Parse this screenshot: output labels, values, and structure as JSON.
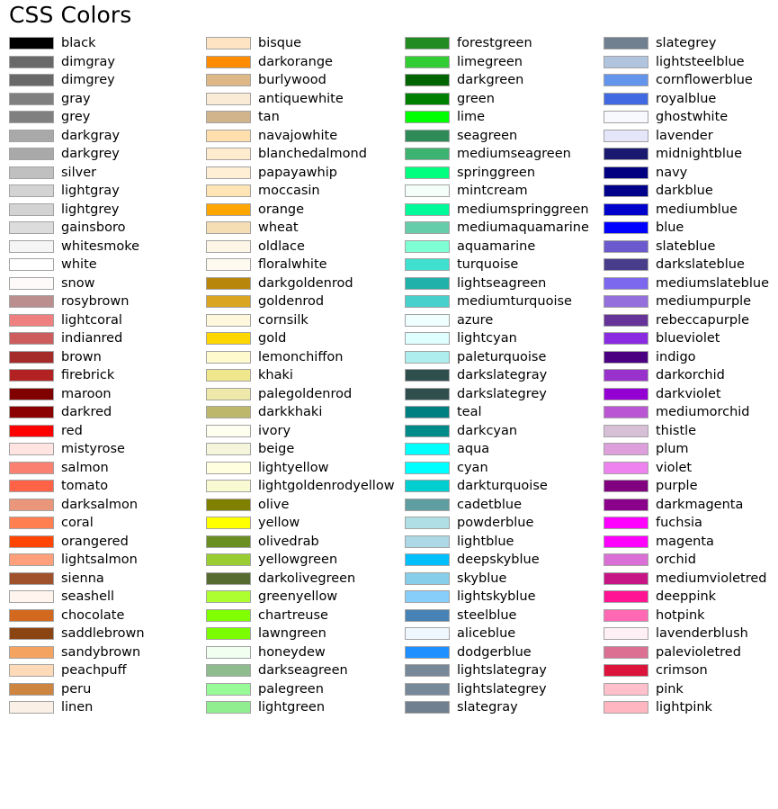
{
  "title": "CSS Colors",
  "background": "#ffffff",
  "swatch_border": "#a3a3a3",
  "chart_data": {
    "type": "table",
    "title": "CSS Colors",
    "xlabel": "",
    "ylabel": "",
    "grid": false,
    "legend_position": "none",
    "layout": {
      "columns": 4,
      "rows_per_column": 42,
      "total_swatches": 148
    },
    "columns": [
      {
        "index": 0,
        "entries": [
          {
            "name": "black",
            "hex": "#000000"
          },
          {
            "name": "dimgray",
            "hex": "#696969"
          },
          {
            "name": "dimgrey",
            "hex": "#696969"
          },
          {
            "name": "gray",
            "hex": "#808080"
          },
          {
            "name": "grey",
            "hex": "#808080"
          },
          {
            "name": "darkgray",
            "hex": "#a9a9a9"
          },
          {
            "name": "darkgrey",
            "hex": "#a9a9a9"
          },
          {
            "name": "silver",
            "hex": "#c0c0c0"
          },
          {
            "name": "lightgray",
            "hex": "#d3d3d3"
          },
          {
            "name": "lightgrey",
            "hex": "#d3d3d3"
          },
          {
            "name": "gainsboro",
            "hex": "#dcdcdc"
          },
          {
            "name": "whitesmoke",
            "hex": "#f5f5f5"
          },
          {
            "name": "white",
            "hex": "#ffffff"
          },
          {
            "name": "snow",
            "hex": "#fffafa"
          },
          {
            "name": "rosybrown",
            "hex": "#bc8f8f"
          },
          {
            "name": "lightcoral",
            "hex": "#f08080"
          },
          {
            "name": "indianred",
            "hex": "#cd5c5c"
          },
          {
            "name": "brown",
            "hex": "#a52a2a"
          },
          {
            "name": "firebrick",
            "hex": "#b22222"
          },
          {
            "name": "maroon",
            "hex": "#800000"
          },
          {
            "name": "darkred",
            "hex": "#8b0000"
          },
          {
            "name": "red",
            "hex": "#ff0000"
          },
          {
            "name": "mistyrose",
            "hex": "#ffe4e1"
          },
          {
            "name": "salmon",
            "hex": "#fa8072"
          },
          {
            "name": "tomato",
            "hex": "#ff6347"
          },
          {
            "name": "darksalmon",
            "hex": "#e9967a"
          },
          {
            "name": "coral",
            "hex": "#ff7f50"
          },
          {
            "name": "orangered",
            "hex": "#ff4500"
          },
          {
            "name": "lightsalmon",
            "hex": "#ffa07a"
          },
          {
            "name": "sienna",
            "hex": "#a0522d"
          },
          {
            "name": "seashell",
            "hex": "#fff5ee"
          },
          {
            "name": "chocolate",
            "hex": "#d2691e"
          },
          {
            "name": "saddlebrown",
            "hex": "#8b4513"
          },
          {
            "name": "sandybrown",
            "hex": "#f4a460"
          },
          {
            "name": "peachpuff",
            "hex": "#ffdab9"
          },
          {
            "name": "peru",
            "hex": "#cd853f"
          },
          {
            "name": "linen",
            "hex": "#faf0e6"
          }
        ]
      },
      {
        "index": 1,
        "entries": [
          {
            "name": "bisque",
            "hex": "#ffe4c4"
          },
          {
            "name": "darkorange",
            "hex": "#ff8c00"
          },
          {
            "name": "burlywood",
            "hex": "#deb887"
          },
          {
            "name": "antiquewhite",
            "hex": "#faebd7"
          },
          {
            "name": "tan",
            "hex": "#d2b48c"
          },
          {
            "name": "navajowhite",
            "hex": "#ffdead"
          },
          {
            "name": "blanchedalmond",
            "hex": "#ffebcd"
          },
          {
            "name": "papayawhip",
            "hex": "#ffefd5"
          },
          {
            "name": "moccasin",
            "hex": "#ffe4b5"
          },
          {
            "name": "orange",
            "hex": "#ffa500"
          },
          {
            "name": "wheat",
            "hex": "#f5deb3"
          },
          {
            "name": "oldlace",
            "hex": "#fdf5e6"
          },
          {
            "name": "floralwhite",
            "hex": "#fffaf0"
          },
          {
            "name": "darkgoldenrod",
            "hex": "#b8860b"
          },
          {
            "name": "goldenrod",
            "hex": "#daa520"
          },
          {
            "name": "cornsilk",
            "hex": "#fff8dc"
          },
          {
            "name": "gold",
            "hex": "#ffd700"
          },
          {
            "name": "lemonchiffon",
            "hex": "#fffacd"
          },
          {
            "name": "khaki",
            "hex": "#f0e68c"
          },
          {
            "name": "palegoldenrod",
            "hex": "#eee8aa"
          },
          {
            "name": "darkkhaki",
            "hex": "#bdb76b"
          },
          {
            "name": "ivory",
            "hex": "#fffff0"
          },
          {
            "name": "beige",
            "hex": "#f5f5dc"
          },
          {
            "name": "lightyellow",
            "hex": "#ffffe0"
          },
          {
            "name": "lightgoldenrodyellow",
            "hex": "#fafad2"
          },
          {
            "name": "olive",
            "hex": "#808000"
          },
          {
            "name": "yellow",
            "hex": "#ffff00"
          },
          {
            "name": "olivedrab",
            "hex": "#6b8e23"
          },
          {
            "name": "yellowgreen",
            "hex": "#9acd32"
          },
          {
            "name": "darkolivegreen",
            "hex": "#556b2f"
          },
          {
            "name": "greenyellow",
            "hex": "#adff2f"
          },
          {
            "name": "chartreuse",
            "hex": "#7fff00"
          },
          {
            "name": "lawngreen",
            "hex": "#7cfc00"
          },
          {
            "name": "honeydew",
            "hex": "#f0fff0"
          },
          {
            "name": "darkseagreen",
            "hex": "#8fbc8f"
          },
          {
            "name": "palegreen",
            "hex": "#98fb98"
          },
          {
            "name": "lightgreen",
            "hex": "#90ee90"
          }
        ]
      },
      {
        "index": 2,
        "entries": [
          {
            "name": "forestgreen",
            "hex": "#228b22"
          },
          {
            "name": "limegreen",
            "hex": "#32cd32"
          },
          {
            "name": "darkgreen",
            "hex": "#006400"
          },
          {
            "name": "green",
            "hex": "#008000"
          },
          {
            "name": "lime",
            "hex": "#00ff00"
          },
          {
            "name": "seagreen",
            "hex": "#2e8b57"
          },
          {
            "name": "mediumseagreen",
            "hex": "#3cb371"
          },
          {
            "name": "springgreen",
            "hex": "#00ff7f"
          },
          {
            "name": "mintcream",
            "hex": "#f5fffa"
          },
          {
            "name": "mediumspringgreen",
            "hex": "#00fa9a"
          },
          {
            "name": "mediumaquamarine",
            "hex": "#66cdaa"
          },
          {
            "name": "aquamarine",
            "hex": "#7fffd4"
          },
          {
            "name": "turquoise",
            "hex": "#40e0d0"
          },
          {
            "name": "lightseagreen",
            "hex": "#20b2aa"
          },
          {
            "name": "mediumturquoise",
            "hex": "#48d1cc"
          },
          {
            "name": "azure",
            "hex": "#f0ffff"
          },
          {
            "name": "lightcyan",
            "hex": "#e0ffff"
          },
          {
            "name": "paleturquoise",
            "hex": "#afeeee"
          },
          {
            "name": "darkslategray",
            "hex": "#2f4f4f"
          },
          {
            "name": "darkslategrey",
            "hex": "#2f4f4f"
          },
          {
            "name": "teal",
            "hex": "#008080"
          },
          {
            "name": "darkcyan",
            "hex": "#008b8b"
          },
          {
            "name": "aqua",
            "hex": "#00ffff"
          },
          {
            "name": "cyan",
            "hex": "#00ffff"
          },
          {
            "name": "darkturquoise",
            "hex": "#00ced1"
          },
          {
            "name": "cadetblue",
            "hex": "#5f9ea0"
          },
          {
            "name": "powderblue",
            "hex": "#b0e0e6"
          },
          {
            "name": "lightblue",
            "hex": "#add8e6"
          },
          {
            "name": "deepskyblue",
            "hex": "#00bfff"
          },
          {
            "name": "skyblue",
            "hex": "#87ceeb"
          },
          {
            "name": "lightskyblue",
            "hex": "#87cefa"
          },
          {
            "name": "steelblue",
            "hex": "#4682b4"
          },
          {
            "name": "aliceblue",
            "hex": "#f0f8ff"
          },
          {
            "name": "dodgerblue",
            "hex": "#1e90ff"
          },
          {
            "name": "lightslategray",
            "hex": "#778899"
          },
          {
            "name": "lightslategrey",
            "hex": "#778899"
          },
          {
            "name": "slategray",
            "hex": "#708090"
          }
        ]
      },
      {
        "index": 3,
        "entries": [
          {
            "name": "slategrey",
            "hex": "#708090"
          },
          {
            "name": "lightsteelblue",
            "hex": "#b0c4de"
          },
          {
            "name": "cornflowerblue",
            "hex": "#6495ed"
          },
          {
            "name": "royalblue",
            "hex": "#4169e1"
          },
          {
            "name": "ghostwhite",
            "hex": "#f8f8ff"
          },
          {
            "name": "lavender",
            "hex": "#e6e6fa"
          },
          {
            "name": "midnightblue",
            "hex": "#191970"
          },
          {
            "name": "navy",
            "hex": "#000080"
          },
          {
            "name": "darkblue",
            "hex": "#00008b"
          },
          {
            "name": "mediumblue",
            "hex": "#0000cd"
          },
          {
            "name": "blue",
            "hex": "#0000ff"
          },
          {
            "name": "slateblue",
            "hex": "#6a5acd"
          },
          {
            "name": "darkslateblue",
            "hex": "#483d8b"
          },
          {
            "name": "mediumslateblue",
            "hex": "#7b68ee"
          },
          {
            "name": "mediumpurple",
            "hex": "#9370db"
          },
          {
            "name": "rebeccapurple",
            "hex": "#663399"
          },
          {
            "name": "blueviolet",
            "hex": "#8a2be2"
          },
          {
            "name": "indigo",
            "hex": "#4b0082"
          },
          {
            "name": "darkorchid",
            "hex": "#9932cc"
          },
          {
            "name": "darkviolet",
            "hex": "#9400d3"
          },
          {
            "name": "mediumorchid",
            "hex": "#ba55d3"
          },
          {
            "name": "thistle",
            "hex": "#d8bfd8"
          },
          {
            "name": "plum",
            "hex": "#dda0dd"
          },
          {
            "name": "violet",
            "hex": "#ee82ee"
          },
          {
            "name": "purple",
            "hex": "#800080"
          },
          {
            "name": "darkmagenta",
            "hex": "#8b008b"
          },
          {
            "name": "fuchsia",
            "hex": "#ff00ff"
          },
          {
            "name": "magenta",
            "hex": "#ff00ff"
          },
          {
            "name": "orchid",
            "hex": "#da70d6"
          },
          {
            "name": "mediumvioletred",
            "hex": "#c71585"
          },
          {
            "name": "deeppink",
            "hex": "#ff1493"
          },
          {
            "name": "hotpink",
            "hex": "#ff69b4"
          },
          {
            "name": "lavenderblush",
            "hex": "#fff0f5"
          },
          {
            "name": "palevioletred",
            "hex": "#db7093"
          },
          {
            "name": "crimson",
            "hex": "#dc143c"
          },
          {
            "name": "pink",
            "hex": "#ffc0cb"
          },
          {
            "name": "lightpink",
            "hex": "#ffb6c1"
          }
        ]
      }
    ]
  }
}
